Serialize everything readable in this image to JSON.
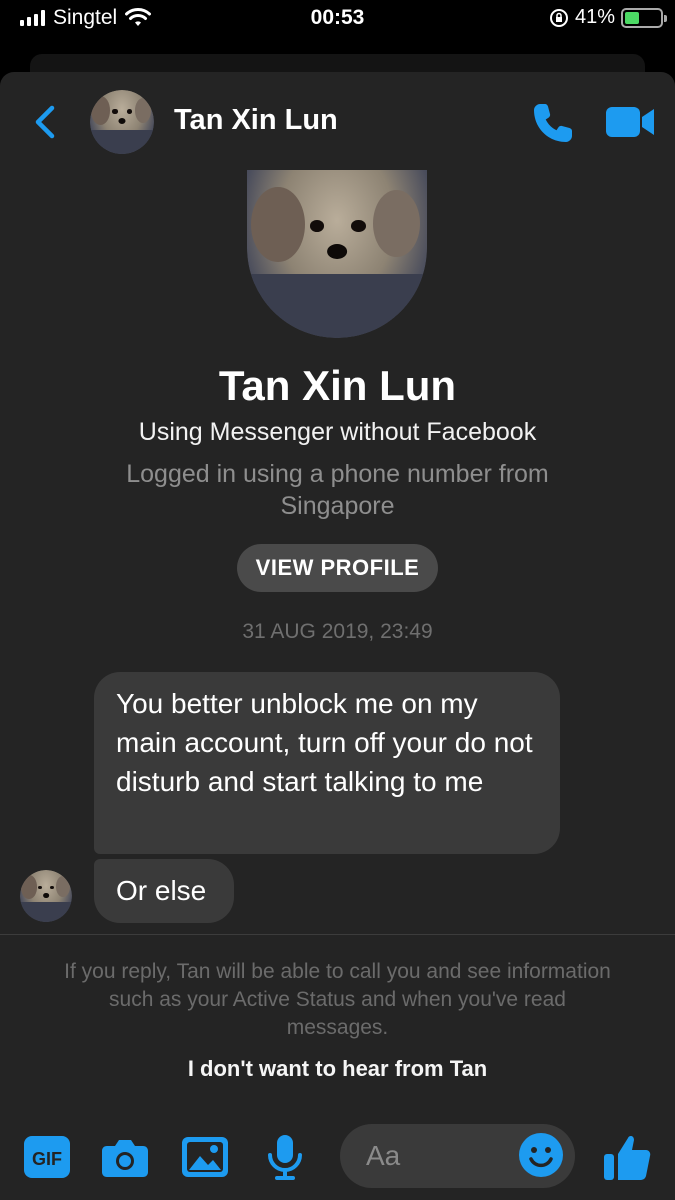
{
  "status_bar": {
    "carrier": "Singtel",
    "time": "00:53",
    "battery": "41%"
  },
  "header": {
    "contact_name": "Tan Xin Lun"
  },
  "profile": {
    "name": "Tan Xin Lun",
    "subtitle": "Using Messenger without Facebook",
    "note": "Logged in using a phone number from Singapore",
    "view_profile_label": "VIEW PROFILE"
  },
  "conversation": {
    "timestamp": "31 AUG 2019, 23:49",
    "messages": [
      {
        "text": "You better unblock me on my main account, turn off your do not disturb and start talking to me"
      },
      {
        "text": "Or else"
      }
    ]
  },
  "request_notice": {
    "text": "If you reply, Tan will be able to call you and see information such as your Active Status and when you've read messages.",
    "block_label": "I don't want to hear from Tan"
  },
  "composer": {
    "gif_label": "GIF",
    "placeholder": "Aa"
  },
  "colors": {
    "accent": "#1d9bf0",
    "background": "#242424",
    "bubble": "#3a3a3a",
    "battery_fill": "#4cd964"
  },
  "icons": {
    "back": "chevron-left-icon",
    "call": "phone-icon",
    "video": "video-camera-icon",
    "camera": "camera-icon",
    "gallery": "image-icon",
    "mic": "microphone-icon",
    "emoji": "smiley-icon",
    "like": "thumbs-up-icon"
  }
}
